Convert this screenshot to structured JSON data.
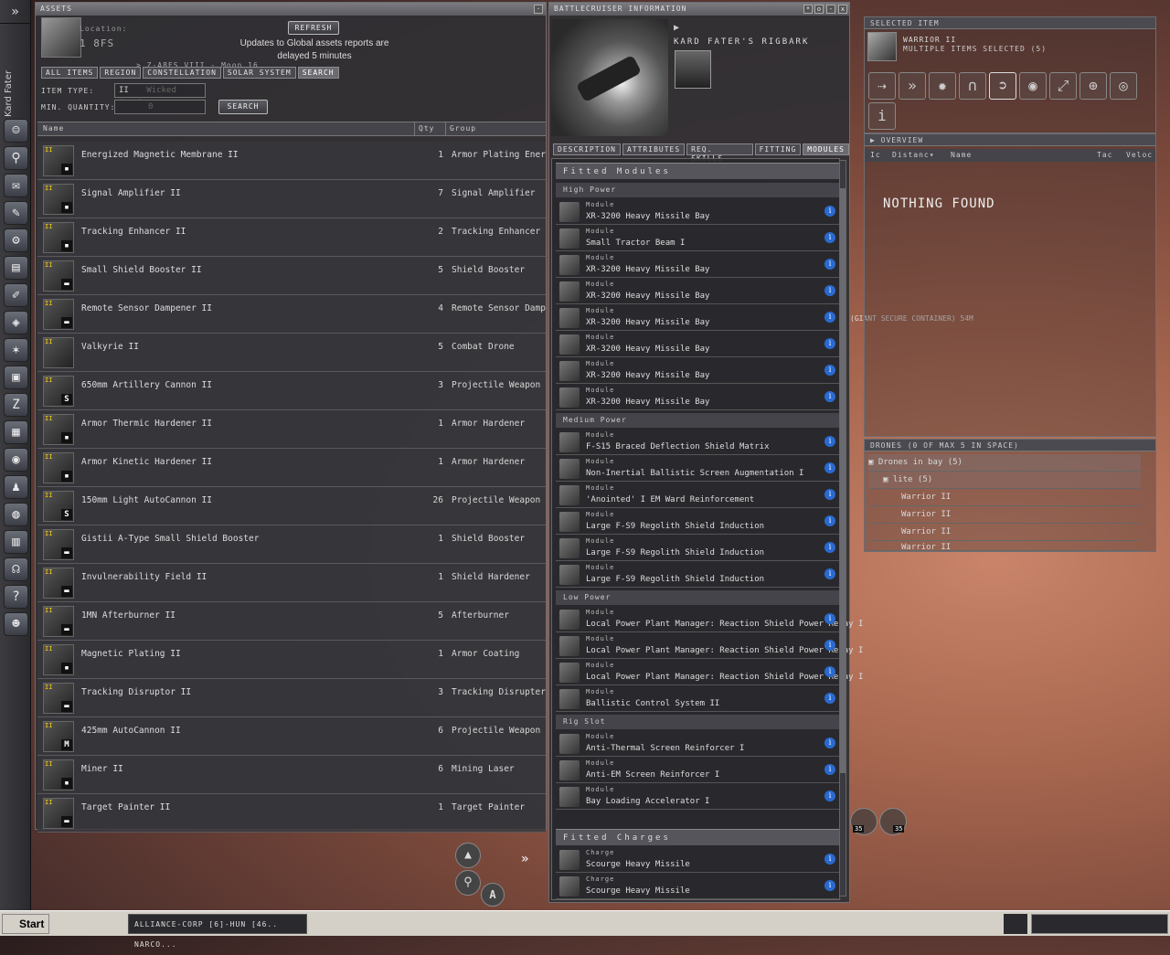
{
  "neocom": {
    "expand": "»",
    "pilot_name": "Kard Fater"
  },
  "assets": {
    "title": "Assets",
    "refresh_label": "Refresh",
    "notice": "Updates to Global assets reports are delayed 5 minutes",
    "location_label": "Location:",
    "location_value": "1 8FS",
    "location_sub": "> Z-A8FS VIII - Moon 16",
    "tabs": [
      "All Items",
      "Region",
      "Constellation",
      "Solar System",
      "Search"
    ],
    "item_type_label": "Item Type:",
    "item_type_value": "II",
    "item_type_placeholder": "Wicked Creek",
    "min_qty_label": "Min. Quantity:",
    "min_qty_value": "0",
    "search_label": "Search",
    "col_name": "Name",
    "col_qty": "Qty",
    "col_group": "Group",
    "rows": [
      {
        "name": "Energized Magnetic Membrane II",
        "qty": "1",
        "group": "Armor Plating Energized",
        "badge": "▪"
      },
      {
        "name": "Signal Amplifier II",
        "qty": "7",
        "group": "Signal Amplifier",
        "badge": "▪"
      },
      {
        "name": "Tracking Enhancer II",
        "qty": "2",
        "group": "Tracking Enhancer",
        "badge": "▪"
      },
      {
        "name": "Small Shield Booster II",
        "qty": "5",
        "group": "Shield Booster",
        "badge": "▬"
      },
      {
        "name": "Remote Sensor Dampener II",
        "qty": "4",
        "group": "Remote Sensor Damper",
        "badge": "▬"
      },
      {
        "name": "Valkyrie II",
        "qty": "5",
        "group": "Combat Drone",
        "badge": ""
      },
      {
        "name": "650mm Artillery Cannon II",
        "qty": "3",
        "group": "Projectile Weapon",
        "badge": "S"
      },
      {
        "name": "Armor Thermic Hardener II",
        "qty": "1",
        "group": "Armor Hardener",
        "badge": "▪"
      },
      {
        "name": "Armor Kinetic Hardener II",
        "qty": "1",
        "group": "Armor Hardener",
        "badge": "▪"
      },
      {
        "name": "150mm Light AutoCannon II",
        "qty": "26",
        "group": "Projectile Weapon",
        "badge": "S"
      },
      {
        "name": "Gistii A-Type Small Shield Booster",
        "qty": "1",
        "group": "Shield Booster",
        "badge": "▬"
      },
      {
        "name": "Invulnerability Field II",
        "qty": "1",
        "group": "Shield Hardener",
        "badge": "▬"
      },
      {
        "name": "1MN Afterburner II",
        "qty": "5",
        "group": "Afterburner",
        "badge": "▬"
      },
      {
        "name": "Magnetic Plating II",
        "qty": "1",
        "group": "Armor Coating",
        "badge": "▪"
      },
      {
        "name": "Tracking Disruptor II",
        "qty": "3",
        "group": "Tracking Disrupter",
        "badge": "▬"
      },
      {
        "name": "425mm AutoCannon II",
        "qty": "6",
        "group": "Projectile Weapon",
        "badge": "M"
      },
      {
        "name": "Miner II",
        "qty": "6",
        "group": "Mining Laser",
        "badge": "▪"
      },
      {
        "name": "Target Painter II",
        "qty": "1",
        "group": "Target Painter",
        "badge": "▬"
      }
    ]
  },
  "bcinfo": {
    "title": "Battlecruiser Information",
    "ship_name": "Kard Fater's Rigbark",
    "tabs": [
      "Description",
      "Attributes",
      "Req. Skills",
      "Fitting",
      "Modules"
    ],
    "fitted_modules_label": "Fitted Modules",
    "fitted_charges_label": "Fitted Charges",
    "groups": {
      "high": {
        "label": "High Power",
        "items": [
          "XR-3200 Heavy Missile Bay",
          "Small Tractor Beam I",
          "XR-3200 Heavy Missile Bay",
          "XR-3200 Heavy Missile Bay",
          "XR-3200 Heavy Missile Bay",
          "XR-3200 Heavy Missile Bay",
          "XR-3200 Heavy Missile Bay",
          "XR-3200 Heavy Missile Bay"
        ]
      },
      "med": {
        "label": "Medium Power",
        "items": [
          "F-S15 Braced Deflection Shield Matrix",
          "Non-Inertial Ballistic Screen Augmentation I",
          "'Anointed' I EM Ward Reinforcement",
          "Large F-S9 Regolith Shield Induction",
          "Large F-S9 Regolith Shield Induction",
          "Large F-S9 Regolith Shield Induction"
        ]
      },
      "low": {
        "label": "Low Power",
        "items": [
          "Local Power Plant Manager: Reaction Shield Power Relay I",
          "Local Power Plant Manager: Reaction Shield Power Relay I",
          "Local Power Plant Manager: Reaction Shield Power Relay I",
          "Ballistic Control System II"
        ]
      },
      "rig": {
        "label": "Rig Slot",
        "items": [
          "Anti-Thermal Screen Reinforcer I",
          "Anti-EM Screen Reinforcer I",
          "Bay Loading Accelerator I"
        ]
      }
    },
    "module_type": "Module",
    "charge_type": "Charge",
    "charges": [
      "Scourge Heavy Missile",
      "Scourge Heavy Missile"
    ]
  },
  "selected_item": {
    "title": "Selected Item",
    "name": "Warrior II",
    "subtitle": "Multiple Items Selected (5)"
  },
  "overview": {
    "title": "Overview",
    "cols": [
      "Ic",
      "Distanc▾",
      "Name",
      "Tac",
      "Veloc"
    ],
    "empty": "Nothing Found"
  },
  "drones": {
    "title": "Drones (0 of max 5 in space)",
    "bay": "Drones in bay (5)",
    "group": "lite (5)",
    "items": [
      "Warrior II",
      "Warrior II",
      "Warrior II",
      "Warrior II"
    ]
  },
  "space_label": "(Giant Secure Container) 54m",
  "hud": {
    "charge1": "35",
    "charge2": "35"
  },
  "taskbar": {
    "start": "Start",
    "item1": "ALLIANCE-CORP [6]-HUN [46..",
    "item2": "NARCO..."
  }
}
